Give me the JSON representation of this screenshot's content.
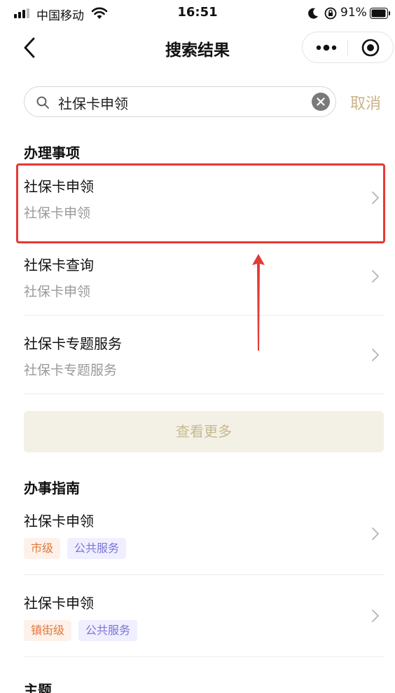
{
  "status_bar": {
    "carrier": "中国移动",
    "time": "16:51",
    "battery": "91%"
  },
  "nav": {
    "title": "搜索结果"
  },
  "search": {
    "value": "社保卡申领",
    "cancel_label": "取消"
  },
  "affairs": {
    "title": "办理事项",
    "items": [
      {
        "title": "社保卡申领",
        "subtitle": "社保卡申领"
      },
      {
        "title": "社保卡查询",
        "subtitle": "社保卡申领"
      },
      {
        "title": "社保卡专题服务",
        "subtitle": "社保卡专题服务"
      }
    ],
    "more_label": "查看更多"
  },
  "guides": {
    "title": "办事指南",
    "items": [
      {
        "title": "社保卡申领",
        "tags": [
          "市级",
          "公共服务"
        ]
      },
      {
        "title": "社保卡申领",
        "tags": [
          "镇街级",
          "公共服务"
        ]
      }
    ]
  },
  "topics": {
    "title": "主题"
  },
  "colors": {
    "accent": "#c9b48a",
    "highlight": "#e53935",
    "tag_level": "#e0793f",
    "tag_type": "#7b74d9"
  }
}
